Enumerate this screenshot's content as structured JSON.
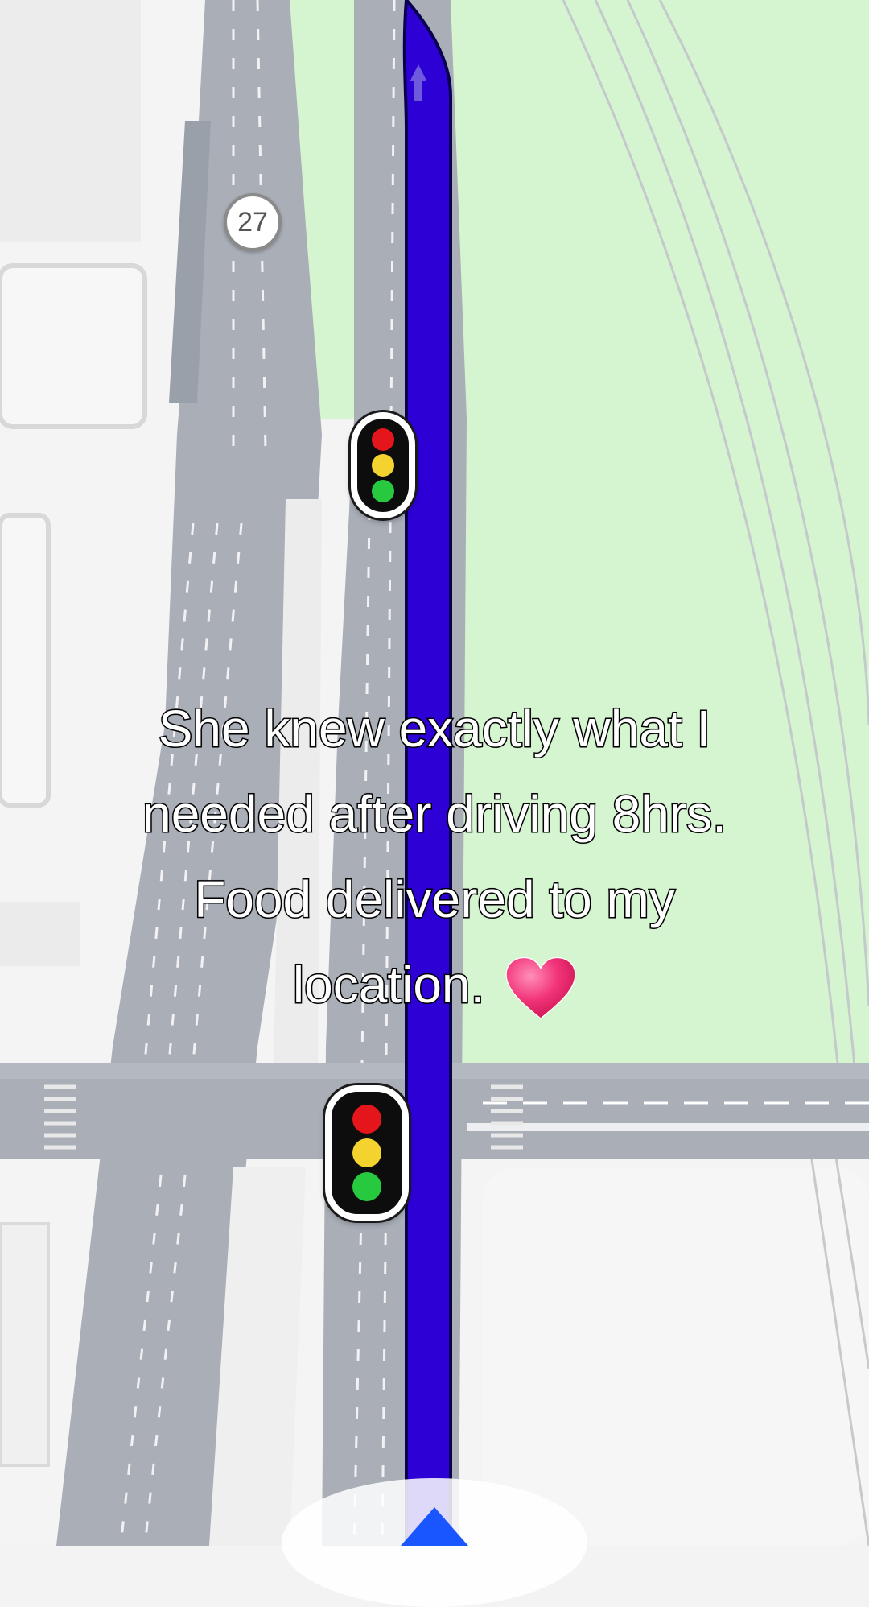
{
  "map": {
    "route_color": "#2d00d6",
    "park_color": "#d4f5d0",
    "road_color": "#a8adb6",
    "road_shield": {
      "label": "27"
    },
    "traffic_lights": [
      {
        "name": "traffic-light-upper",
        "lamps": [
          "red",
          "yellow",
          "green"
        ]
      },
      {
        "name": "traffic-light-lower",
        "lamps": [
          "red",
          "yellow",
          "green"
        ]
      }
    ]
  },
  "caption": {
    "lines": [
      "She knew exactly what I",
      "needed after driving 8hrs.",
      "Food delivered to my",
      "location."
    ],
    "emoji": "heart-emoji"
  },
  "navigation": {
    "position_icon": "nav-arrow-icon",
    "arrow_color": "#1a56ff"
  }
}
